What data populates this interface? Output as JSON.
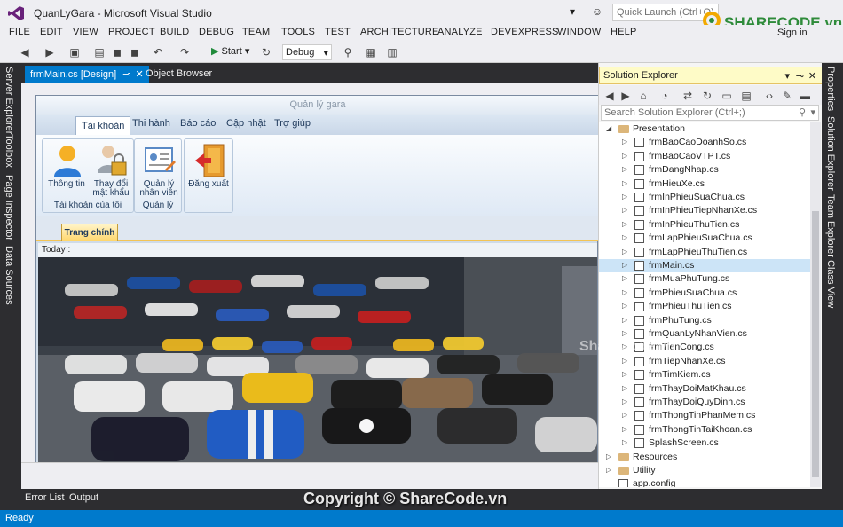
{
  "titlebar": {
    "title": "QuanLyGara - Microsoft Visual Studio",
    "quick_launch_placeholder": "Quick Launch (Ctrl+Q)",
    "sign_in": "Sign in",
    "logo_text": "SHARECODE.vn"
  },
  "menu": [
    "FILE",
    "EDIT",
    "VIEW",
    "PROJECT",
    "BUILD",
    "DEBUG",
    "TEAM",
    "TOOLS",
    "TEST",
    "ARCHITECTURE",
    "ANALYZE",
    "DEVEXPRESS",
    "WINDOW",
    "HELP"
  ],
  "toolbar": {
    "start_label": "Start",
    "config": "Debug"
  },
  "left_rail": [
    "Server Explorer",
    "Toolbox",
    "Page Inspector",
    "Data Sources"
  ],
  "doc_tabs": {
    "active": "frmMain.cs [Design]",
    "inactive": "Object Browser"
  },
  "form": {
    "caption": "Quản lý gara",
    "ribbon_tabs": [
      "Tài khoản",
      "Thi hành",
      "Báo cáo",
      "Cập nhật",
      "Trợ giúp"
    ],
    "groups": [
      {
        "label": "Tài khoản của tôi",
        "buttons": [
          "Thông tin",
          "Thay đổi mật khẩu"
        ]
      },
      {
        "label": "Quản lý",
        "buttons": [
          "Quản lý nhân viên"
        ]
      },
      {
        "label": "",
        "buttons": [
          "Đăng xuất"
        ]
      }
    ],
    "page_tab": "Trang chính",
    "today_label": "Today :"
  },
  "bottom_tabs": [
    "Error List",
    "Output"
  ],
  "copyright": "Copyright © ShareCode.vn",
  "watermark": "ShareCode.vn",
  "status": "Ready",
  "solution_explorer": {
    "title": "Solution Explorer",
    "search_placeholder": "Search Solution Explorer (Ctrl+;)",
    "tree": [
      {
        "label": "Presentation",
        "type": "folder",
        "expanded": true,
        "level": 0
      },
      {
        "label": "frmBaoCaoDoanhSo.cs",
        "type": "file",
        "level": 1
      },
      {
        "label": "frmBaoCaoVTPT.cs",
        "type": "file",
        "level": 1
      },
      {
        "label": "frmDangNhap.cs",
        "type": "file",
        "level": 1
      },
      {
        "label": "frmHieuXe.cs",
        "type": "file",
        "level": 1
      },
      {
        "label": "frmInPhieuSuaChua.cs",
        "type": "file",
        "level": 1
      },
      {
        "label": "frmInPhieuTiepNhanXe.cs",
        "type": "file",
        "level": 1
      },
      {
        "label": "frmInPhieuThuTien.cs",
        "type": "file",
        "level": 1
      },
      {
        "label": "frmLapPhieuSuaChua.cs",
        "type": "file",
        "level": 1
      },
      {
        "label": "frmLapPhieuThuTien.cs",
        "type": "file",
        "level": 1
      },
      {
        "label": "frmMain.cs",
        "type": "file",
        "level": 1,
        "selected": true
      },
      {
        "label": "frmMuaPhuTung.cs",
        "type": "file",
        "level": 1
      },
      {
        "label": "frmPhieuSuaChua.cs",
        "type": "file",
        "level": 1
      },
      {
        "label": "frmPhieuThuTien.cs",
        "type": "file",
        "level": 1
      },
      {
        "label": "frmPhuTung.cs",
        "type": "file",
        "level": 1
      },
      {
        "label": "frmQuanLyNhanVien.cs",
        "type": "file",
        "level": 1
      },
      {
        "label": "frmTienCong.cs",
        "type": "file",
        "level": 1
      },
      {
        "label": "frmTiepNhanXe.cs",
        "type": "file",
        "level": 1
      },
      {
        "label": "frmTimKiem.cs",
        "type": "file",
        "level": 1
      },
      {
        "label": "frmThayDoiMatKhau.cs",
        "type": "file",
        "level": 1
      },
      {
        "label": "frmThayDoiQuyDinh.cs",
        "type": "file",
        "level": 1
      },
      {
        "label": "frmThongTinPhanMem.cs",
        "type": "file",
        "level": 1
      },
      {
        "label": "frmThongTinTaiKhoan.cs",
        "type": "file",
        "level": 1
      },
      {
        "label": "SplashScreen.cs",
        "type": "file",
        "level": 1
      },
      {
        "label": "Resources",
        "type": "folder",
        "expanded": false,
        "level": 0
      },
      {
        "label": "Utility",
        "type": "folder",
        "expanded": false,
        "level": 0
      },
      {
        "label": "app.config",
        "type": "config",
        "level": 0
      }
    ]
  },
  "right_rail": [
    "Properties",
    "Solution Explorer",
    "Team Explorer",
    "Class View"
  ]
}
